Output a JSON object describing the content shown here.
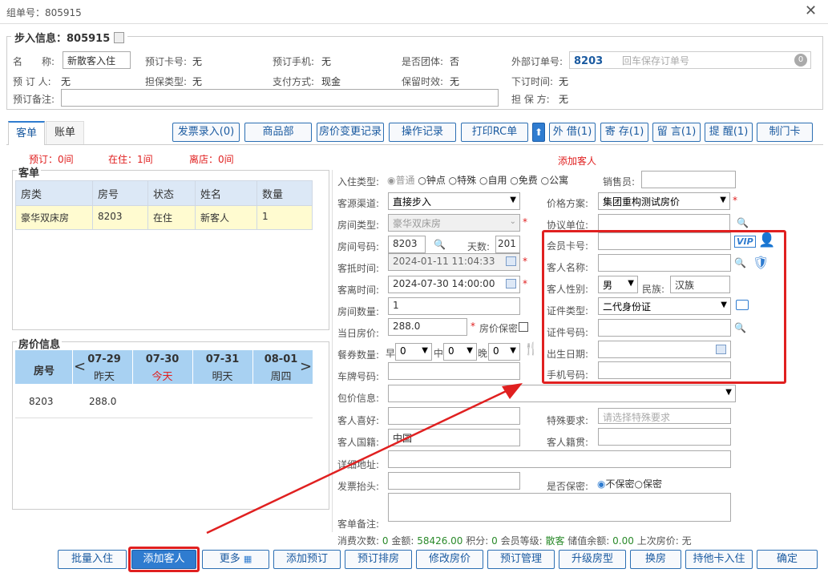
{
  "window": {
    "title": "组单号：805915"
  },
  "checkin_info": {
    "legend": "步入信息：805915",
    "name_label": "名　　称:",
    "name_value": "新散客入住",
    "booking_card_label": "预订卡号:",
    "booking_card_value": "无",
    "booking_phone_label": "预订手机:",
    "booking_phone_value": "无",
    "group_label": "是否团体:",
    "group_value": "否",
    "external_order_label": "外部订单号:",
    "external_order_value": "8203",
    "external_order_hint": "回车保存订单号",
    "external_badge": "0",
    "booker_label": "预 订 人:",
    "booker_value": "无",
    "guarantee_type_label": "担保类型:",
    "guarantee_type_value": "无",
    "payment_label": "支付方式:",
    "payment_value": "现金",
    "retain_label": "保留时效:",
    "retain_value": "无",
    "order_time_label": "下订时间:",
    "order_time_value": "无",
    "remark_label": "预订备注:",
    "guarantor_label": "担 保 方:",
    "guarantor_value": "无"
  },
  "tabs": {
    "guest": "客单",
    "bill": "账单"
  },
  "toolbar": [
    "发票录入(0)",
    "商品部",
    "房价变更记录",
    "操作记录",
    "打印RC单",
    "外 借(1)",
    "寄 存(1)",
    "留 言(1)",
    "提 醒(1)",
    "制门卡"
  ],
  "summary": {
    "booked": "预订：0间",
    "in_house": "在住：1间",
    "left": "离店：0间",
    "add_guest_title": "添加客人"
  },
  "guest_list": {
    "title": "客单",
    "headers": [
      "房类",
      "房号",
      "状态",
      "姓名",
      "数量"
    ],
    "row": [
      "豪华双床房",
      "8203",
      "在住",
      "新客人",
      "1"
    ]
  },
  "price_info": {
    "title": "房价信息",
    "room_header": "房号",
    "days": [
      {
        "date": "07-29",
        "name": "昨天"
      },
      {
        "date": "07-30",
        "name": "今天"
      },
      {
        "date": "07-31",
        "name": "明天"
      },
      {
        "date": "08-01",
        "name": "周四"
      }
    ],
    "room": "8203",
    "price": "288.0",
    "prev": "<",
    "next": ">"
  },
  "form": {
    "checkin_type_label": "入住类型:",
    "checkin_types": [
      "普通",
      "钟点",
      "特殊",
      "自用",
      "免费",
      "公寓"
    ],
    "sales_label": "销售员:",
    "channel_label": "客源渠道:",
    "channel_value": "直接步入",
    "price_plan_label": "价格方案:",
    "price_plan_value": "集团重构测试房价",
    "room_type_label": "房间类型:",
    "room_type_value": "豪华双床房",
    "agreement_label": "协议单位:",
    "room_no_label": "房间号码:",
    "room_no_value": "8203",
    "days_label": "天数:",
    "days_value": "201",
    "arrive_label": "客抵时间:",
    "arrive_value": "2024-01-11 11:04:33",
    "depart_label": "客离时间:",
    "depart_value": "2024-07-30 14:00:00",
    "room_count_label": "房间数量:",
    "room_count_value": "1",
    "day_price_label": "当日房价:",
    "day_price_value": "288.0",
    "price_secret_label": "房价保密",
    "meal_label": "餐券数量:",
    "breakfast": "早",
    "lunch": "中",
    "dinner": "晚",
    "meal_value": "0",
    "plate_label": "车牌号码:",
    "package_label": "包价信息:",
    "pref_label": "客人喜好:",
    "special_label": "特殊要求:",
    "special_placeholder": "请选择特殊要求",
    "nationality_label": "客人国籍:",
    "nationality_value": "中国",
    "native_label": "客人籍贯:",
    "address_label": "详细地址:",
    "invoice_label": "发票抬头:",
    "secret_label": "是否保密:",
    "not_secret": "不保密",
    "secret": "保密",
    "order_remark_label": "客单备注:",
    "member_card_label": "会员卡号:",
    "vip": "VIP",
    "guest_name_label": "客人名称:",
    "gender_label": "客人性别:",
    "gender_value": "男",
    "ethnic_label": "民族:",
    "ethnic_value": "汉族",
    "id_type_label": "证件类型:",
    "id_type_value": "二代身份证",
    "id_no_label": "证件号码:",
    "birth_label": "出生日期:",
    "mobile_label": "手机号码:"
  },
  "stats": {
    "text1": "消费次数: ",
    "v1": "0",
    "text2": " 金额: ",
    "v2": "58426.00",
    "text3": " 积分: ",
    "v3": "0",
    "text4": " 会员等级: ",
    "v4": "散客",
    "text5": " 储值余额: ",
    "v5": "0.00",
    "text6": " 上次房价: ",
    "v6": "无"
  },
  "bottom_buttons": [
    "批量入住",
    "添加客人",
    "更多",
    "添加预订",
    "预订排房",
    "修改房价",
    "预订管理",
    "升级房型",
    "换房",
    "持他卡入住",
    "确定"
  ]
}
